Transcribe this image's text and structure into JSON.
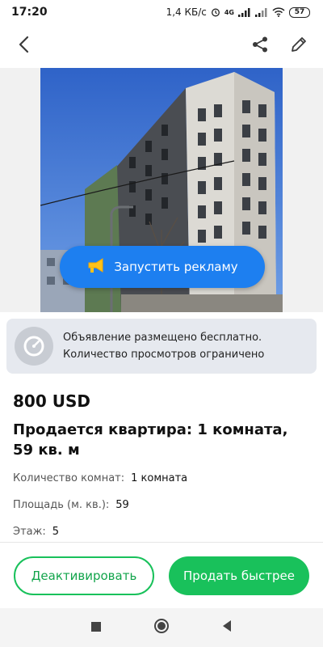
{
  "status_bar": {
    "time": "17:20",
    "speed": "1,4 КБ/с",
    "network": "4G",
    "battery": "57"
  },
  "top_bar": {
    "back_icon": "arrow-back-icon",
    "share_icon": "share-icon",
    "edit_icon": "pencil-icon"
  },
  "media": {
    "promo_label": "Запустить рекламу",
    "promo_icon": "megaphone-icon"
  },
  "notice": {
    "icon": "speedometer-icon",
    "line1": "Объявление размещено бесплатно.",
    "line2": "Количество просмотров ограничено"
  },
  "listing": {
    "price": "800 USD",
    "title": "Продается квартира: 1 комната, 59 кв. м",
    "details": [
      {
        "label": "Количество комнат:",
        "value": "1 комната"
      },
      {
        "label": "Площадь (м. кв.):",
        "value": "59"
      },
      {
        "label": "Этаж:",
        "value": "5"
      }
    ]
  },
  "actions": {
    "deactivate_label": "Деактивировать",
    "sell_faster_label": "Продать быстрее"
  },
  "colors": {
    "accent_green": "#19c15b",
    "promo_blue": "#1d7ff0",
    "notice_bg": "#e6e9ef"
  }
}
